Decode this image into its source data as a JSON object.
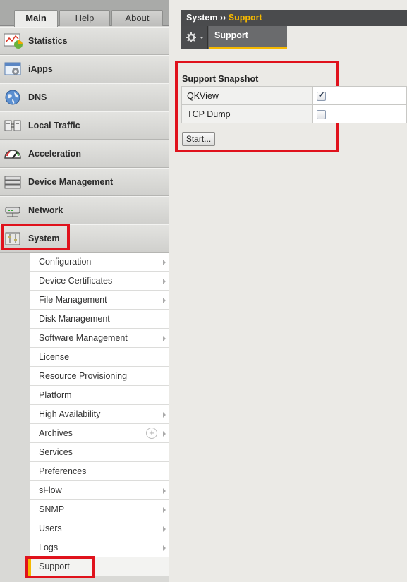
{
  "tabs": [
    {
      "label": "Main",
      "active": true
    },
    {
      "label": "Help",
      "active": false
    },
    {
      "label": "About",
      "active": false
    }
  ],
  "nav": [
    {
      "label": "Statistics",
      "icon": "statistics-icon"
    },
    {
      "label": "iApps",
      "icon": "iapps-icon"
    },
    {
      "label": "DNS",
      "icon": "globe-icon"
    },
    {
      "label": "Local Traffic",
      "icon": "local-traffic-icon"
    },
    {
      "label": "Acceleration",
      "icon": "gauge-icon"
    },
    {
      "label": "Device Management",
      "icon": "device-management-icon"
    },
    {
      "label": "Network",
      "icon": "network-icon"
    },
    {
      "label": "System",
      "icon": "system-icon"
    }
  ],
  "submenu": [
    {
      "label": "Configuration",
      "arrow": true
    },
    {
      "label": "Device Certificates",
      "arrow": true
    },
    {
      "label": "File Management",
      "arrow": true
    },
    {
      "label": "Disk Management",
      "arrow": false
    },
    {
      "label": "Software Management",
      "arrow": true
    },
    {
      "label": "License",
      "arrow": false
    },
    {
      "label": "Resource Provisioning",
      "arrow": false
    },
    {
      "label": "Platform",
      "arrow": false
    },
    {
      "label": "High Availability",
      "arrow": true
    },
    {
      "label": "Archives",
      "arrow": true,
      "plus": true
    },
    {
      "label": "Services",
      "arrow": false
    },
    {
      "label": "Preferences",
      "arrow": false
    },
    {
      "label": "sFlow",
      "arrow": true
    },
    {
      "label": "SNMP",
      "arrow": true
    },
    {
      "label": "Users",
      "arrow": true
    },
    {
      "label": "Logs",
      "arrow": true
    },
    {
      "label": "Support",
      "arrow": false,
      "selected": true
    }
  ],
  "breadcrumb": {
    "section": "System",
    "separator": "››",
    "current": "Support"
  },
  "subtab": {
    "label": "Support"
  },
  "snapshot": {
    "title": "Support Snapshot",
    "rows": [
      {
        "label": "QKView",
        "checked": true
      },
      {
        "label": "TCP Dump",
        "checked": false
      }
    ],
    "start_label": "Start..."
  },
  "colors": {
    "highlight_red": "#e0121c",
    "accent_yellow": "#f5b800",
    "breadcrumb_bg": "#4a4b4d"
  }
}
